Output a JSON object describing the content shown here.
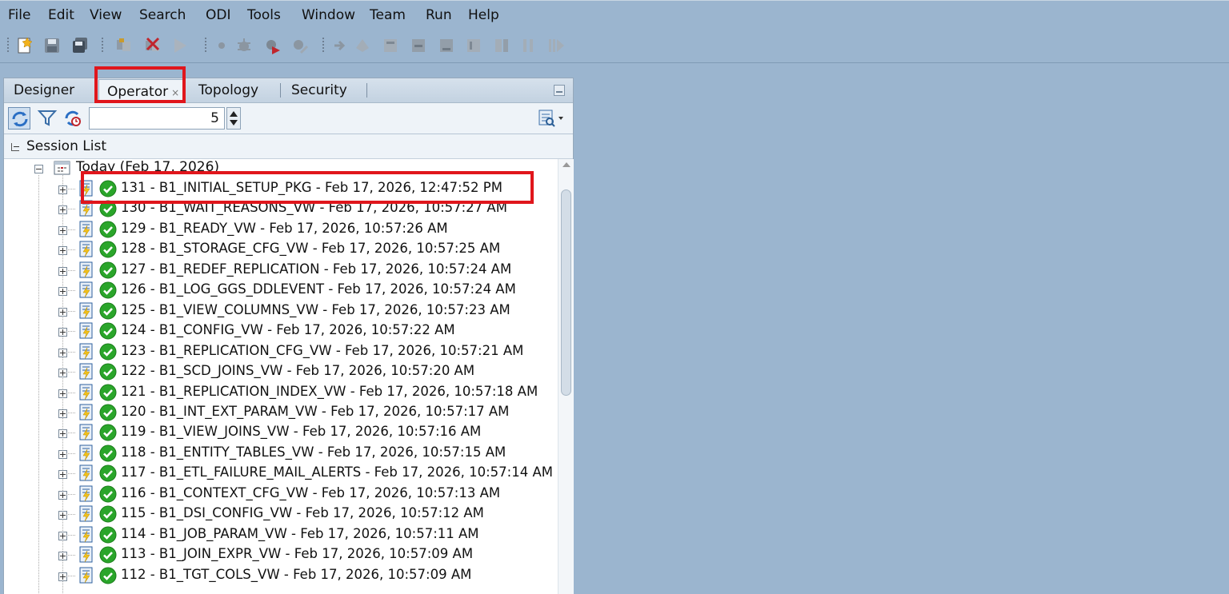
{
  "menubar": {
    "items": [
      "File",
      "Edit",
      "View",
      "Search",
      "ODI",
      "Tools",
      "Window",
      "Team",
      "Run",
      "Help"
    ]
  },
  "toolbar": {
    "icons": [
      "new-icon",
      "save-icon",
      "save-all-icon",
      "copy-icon",
      "delete-icon",
      "run-icon",
      "breakpoint-icon",
      "debug-icon",
      "debug-run-icon",
      "debug-wrench-icon",
      "step-into-icon",
      "step-over-icon",
      "step-icon",
      "step-out-icon",
      "step-next-icon",
      "step-end-icon",
      "pause-icon",
      "resume-icon"
    ]
  },
  "tabs": [
    {
      "label": "Designer",
      "active": false
    },
    {
      "label": "Operator",
      "active": true,
      "close": "×"
    },
    {
      "label": "Topology",
      "active": false
    },
    {
      "label": "Security",
      "active": false
    }
  ],
  "operator_toolbar": {
    "icons": [
      "refresh-icon",
      "filter-icon",
      "auto-refresh-icon"
    ],
    "spinner_value": "5",
    "search_icon": "search-options-icon"
  },
  "session_list": {
    "title": "Session List",
    "date_node": "Today (Feb 17, 2026)",
    "status_icon": "success-check-icon",
    "status_color": "#2aa52a",
    "sessions": [
      "131 - B1_INITIAL_SETUP_PKG - Feb 17, 2026, 12:47:52 PM",
      "130 - B1_WAIT_REASONS_VW - Feb 17, 2026, 10:57:27 AM",
      "129 - B1_READY_VW - Feb 17, 2026, 10:57:26 AM",
      "128 - B1_STORAGE_CFG_VW - Feb 17, 2026, 10:57:25 AM",
      "127 - B1_REDEF_REPLICATION - Feb 17, 2026, 10:57:24 AM",
      "126 - B1_LOG_GGS_DDLEVENT - Feb 17, 2026, 10:57:24 AM",
      "125 - B1_VIEW_COLUMNS_VW - Feb 17, 2026, 10:57:23 AM",
      "124 - B1_CONFIG_VW - Feb 17, 2026, 10:57:22 AM",
      "123 - B1_REPLICATION_CFG_VW - Feb 17, 2026, 10:57:21 AM",
      "122 - B1_SCD_JOINS_VW - Feb 17, 2026, 10:57:20 AM",
      "121 - B1_REPLICATION_INDEX_VW - Feb 17, 2026, 10:57:18 AM",
      "120 - B1_INT_EXT_PARAM_VW - Feb 17, 2026, 10:57:17 AM",
      "119 - B1_VIEW_JOINS_VW - Feb 17, 2026, 10:57:16 AM",
      "118 - B1_ENTITY_TABLES_VW - Feb 17, 2026, 10:57:15 AM",
      "117 - B1_ETL_FAILURE_MAIL_ALERTS - Feb 17, 2026, 10:57:14 AM",
      "116 - B1_CONTEXT_CFG_VW - Feb 17, 2026, 10:57:13 AM",
      "115 - B1_DSI_CONFIG_VW - Feb 17, 2026, 10:57:12 AM",
      "114 - B1_JOB_PARAM_VW - Feb 17, 2026, 10:57:11 AM",
      "113 - B1_JOIN_EXPR_VW - Feb 17, 2026, 10:57:09 AM",
      "112 - B1_TGT_COLS_VW - Feb 17, 2026, 10:57:09 AM"
    ]
  },
  "highlight_color": "#e0161c"
}
